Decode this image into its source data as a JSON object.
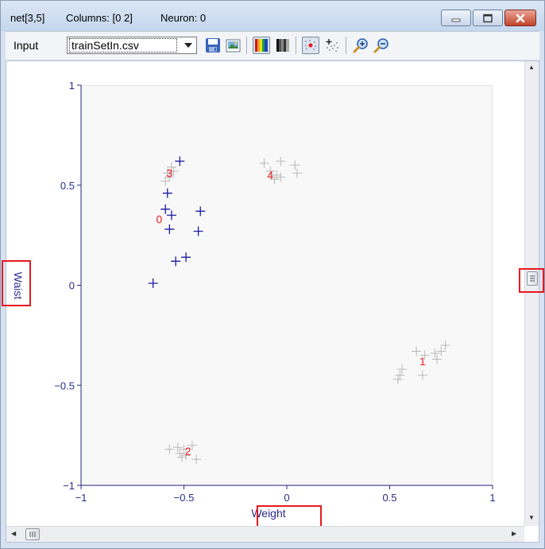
{
  "window": {
    "net_label": "net[3,5]",
    "columns_label": "Columns: [0  2]",
    "neuron_label": "Neuron: 0"
  },
  "toolbar": {
    "input_label": "Input",
    "file_selected": "trainSetIn.csv"
  },
  "icons": [
    "minimize-icon",
    "maximize-icon",
    "close-icon",
    "save-icon",
    "export-image-icon",
    "color-map-icon",
    "grayscale-map-icon",
    "show-points-icon",
    "scatter-icon",
    "zoom-in-icon",
    "zoom-out-icon"
  ],
  "colors": {
    "axis": "#2b2b8a",
    "neuron_label": "#e8191f",
    "selected_points": "#1a1aa6",
    "other_points": "#b8b8b8",
    "highlight_box": "#e8191f"
  },
  "chart_data": {
    "type": "scatter",
    "xlabel": "Weight",
    "ylabel": "Waist",
    "xlim": [
      -1,
      1
    ],
    "ylim": [
      -1,
      1
    ],
    "x_ticks": [
      -1,
      -0.5,
      0,
      0.5,
      1
    ],
    "y_ticks": [
      -1,
      -0.5,
      0,
      0.5,
      1
    ],
    "x_tick_labels": [
      "−1",
      "−0.5",
      "0",
      "0.5",
      "1"
    ],
    "y_tick_labels": [
      "−1",
      "−0.5",
      "0",
      "0.5",
      "1"
    ],
    "grid": false,
    "series": [
      {
        "points": [
          [
            -0.52,
            0.62
          ],
          [
            -0.58,
            0.46
          ],
          [
            -0.59,
            0.38
          ],
          [
            -0.56,
            0.35
          ],
          [
            -0.57,
            0.28
          ],
          [
            -0.42,
            0.37
          ],
          [
            -0.43,
            0.27
          ],
          [
            -0.49,
            0.14
          ],
          [
            -0.54,
            0.12
          ],
          [
            -0.65,
            0.01
          ]
        ]
      },
      {
        "points": [
          [
            -0.56,
            0.59
          ],
          [
            -0.55,
            0.57
          ],
          [
            -0.58,
            0.56
          ],
          [
            -0.57,
            0.54
          ],
          [
            -0.59,
            0.52
          ]
        ]
      },
      {
        "points": [
          [
            -0.11,
            0.61
          ],
          [
            -0.03,
            0.62
          ],
          [
            0.04,
            0.6
          ],
          [
            0.05,
            0.56
          ],
          [
            -0.08,
            0.57
          ],
          [
            -0.05,
            0.55
          ],
          [
            -0.03,
            0.54
          ],
          [
            -0.06,
            0.53
          ]
        ]
      },
      {
        "points": [
          [
            0.63,
            -0.33
          ],
          [
            0.67,
            -0.35
          ],
          [
            0.72,
            -0.34
          ],
          [
            0.75,
            -0.33
          ],
          [
            0.77,
            -0.3
          ],
          [
            0.73,
            -0.37
          ],
          [
            0.56,
            -0.42
          ],
          [
            0.55,
            -0.45
          ],
          [
            0.54,
            -0.47
          ],
          [
            0.66,
            -0.45
          ]
        ]
      },
      {
        "points": [
          [
            -0.57,
            -0.82
          ],
          [
            -0.53,
            -0.81
          ],
          [
            -0.5,
            -0.82
          ],
          [
            -0.46,
            -0.8
          ],
          [
            -0.52,
            -0.84
          ],
          [
            -0.49,
            -0.85
          ],
          [
            -0.44,
            -0.87
          ],
          [
            -0.51,
            -0.86
          ]
        ]
      }
    ],
    "neurons": [
      {
        "label": "0",
        "x": -0.62,
        "y": 0.33
      },
      {
        "label": "1",
        "x": 0.66,
        "y": -0.38
      },
      {
        "label": "2",
        "x": -0.48,
        "y": -0.83
      },
      {
        "label": "3",
        "x": -0.57,
        "y": 0.56
      },
      {
        "label": "4",
        "x": -0.08,
        "y": 0.55
      }
    ]
  }
}
